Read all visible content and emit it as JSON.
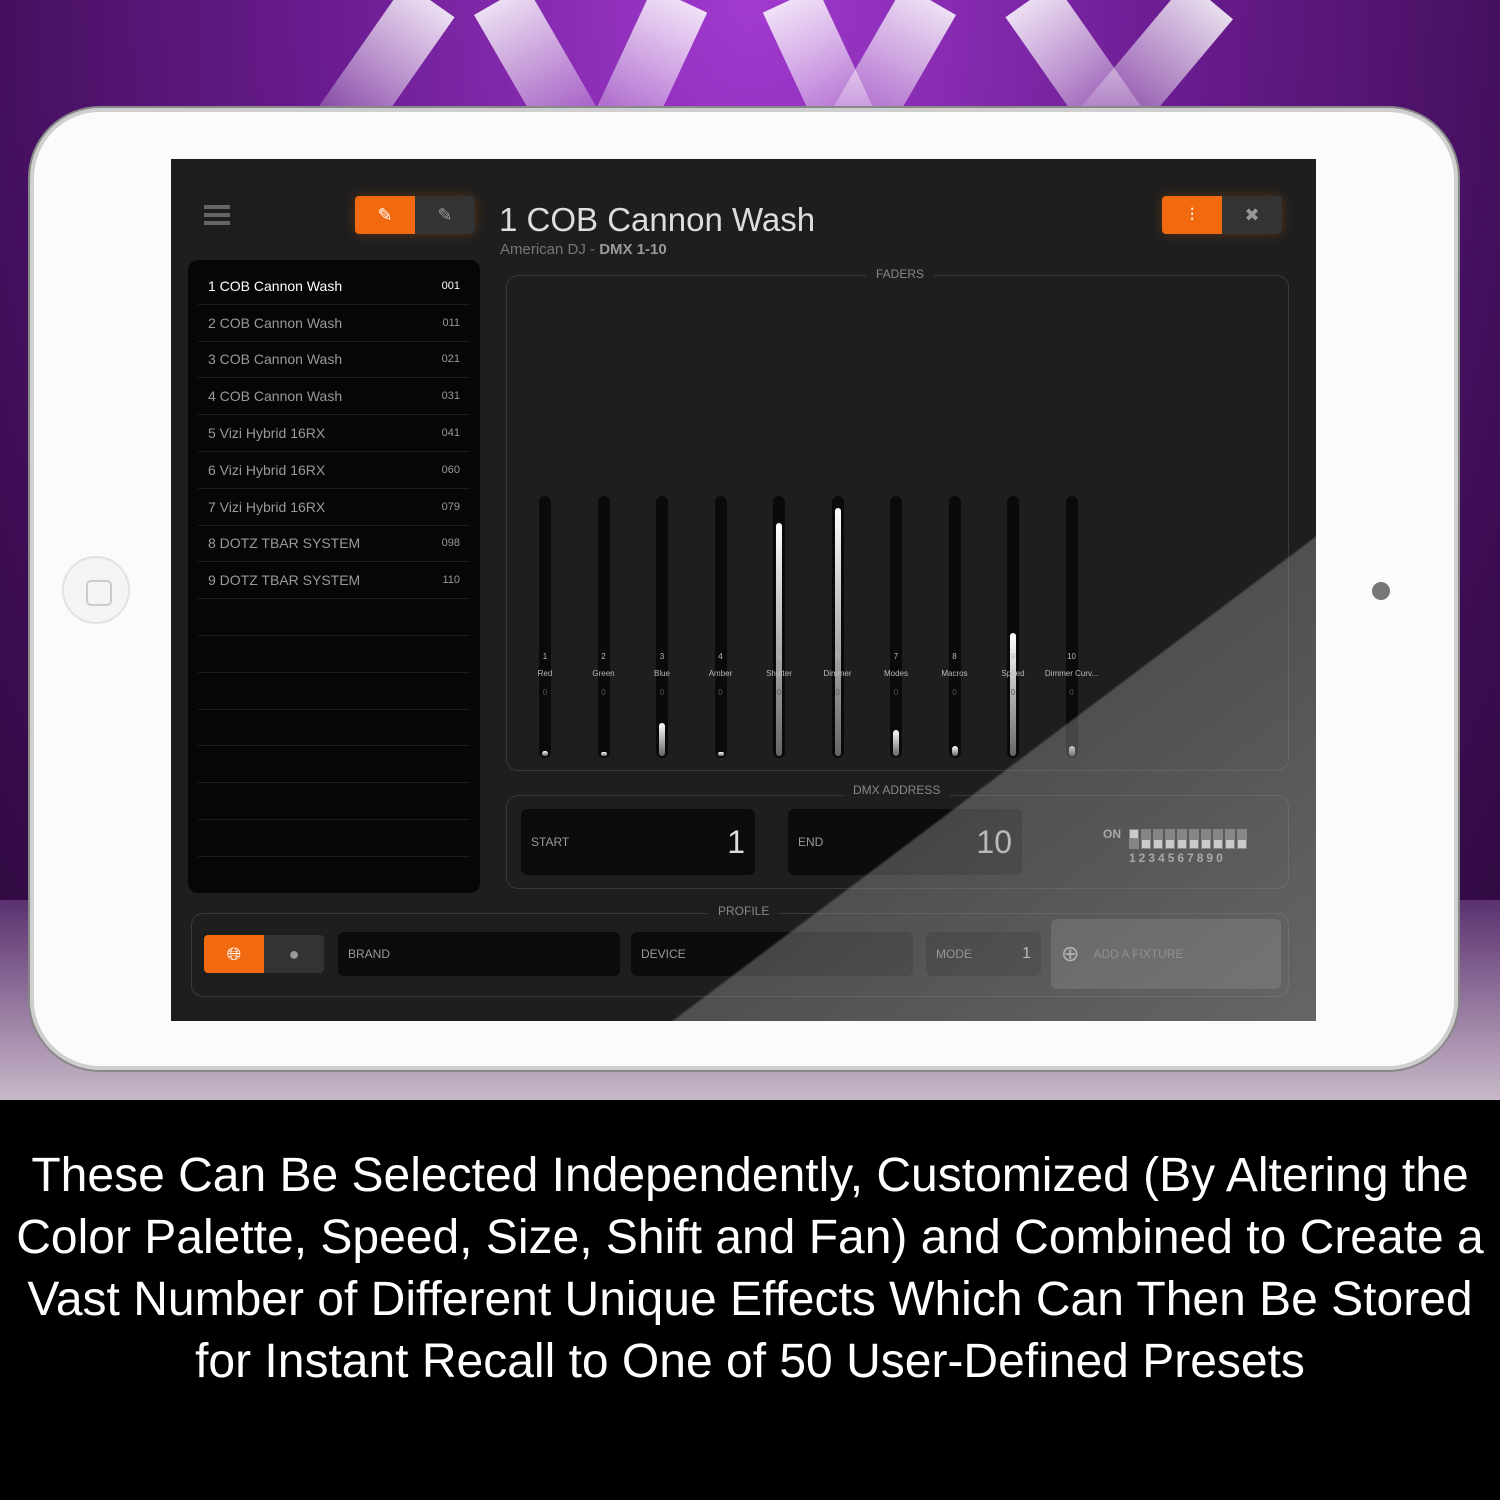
{
  "app": {
    "title": "1 COB Cannon Wash",
    "subtitle_brand": "American DJ",
    "subtitle_sep": " - ",
    "subtitle_dmx": "DMX 1-10",
    "accent": "#f26a10"
  },
  "fixtures": [
    {
      "name": "1 COB Cannon Wash",
      "addr": "001",
      "selected": true
    },
    {
      "name": "2 COB Cannon Wash",
      "addr": "011"
    },
    {
      "name": "3 COB Cannon Wash",
      "addr": "021"
    },
    {
      "name": "4 COB Cannon Wash",
      "addr": "031"
    },
    {
      "name": "5 Vizi Hybrid 16RX",
      "addr": "041"
    },
    {
      "name": "6 Vizi Hybrid 16RX",
      "addr": "060"
    },
    {
      "name": "7 Vizi Hybrid 16RX",
      "addr": "079"
    },
    {
      "name": "8 DOTZ TBAR SYSTEM",
      "addr": "098"
    },
    {
      "name": "9 DOTZ TBAR SYSTEM",
      "addr": "110"
    }
  ],
  "faders": {
    "label": "FADERS",
    "channels": [
      {
        "num": "1",
        "name": "Red",
        "value": "0",
        "level": 0.02
      },
      {
        "num": "2",
        "name": "Green",
        "value": "0",
        "level": 0.0
      },
      {
        "num": "3",
        "name": "Blue",
        "value": "0",
        "level": 0.13
      },
      {
        "num": "4",
        "name": "Amber",
        "value": "0",
        "level": 0.0
      },
      {
        "num": "5",
        "name": "Shutter",
        "value": "0",
        "level": 0.91
      },
      {
        "num": "6",
        "name": "Dimmer",
        "value": "0",
        "level": 0.97
      },
      {
        "num": "7",
        "name": "Modes",
        "value": "0",
        "level": 0.1
      },
      {
        "num": "8",
        "name": "Macros",
        "value": "0",
        "level": 0.04
      },
      {
        "num": "9",
        "name": "Speed",
        "value": "0",
        "level": 0.48
      },
      {
        "num": "10",
        "name": "Dimmer Curv...",
        "value": "0",
        "level": 0.04
      }
    ]
  },
  "dmx": {
    "label": "DMX ADDRESS",
    "start_label": "START",
    "start": "1",
    "end_label": "END",
    "end": "10",
    "dip_on": "ON",
    "dip_digits": "1234567890",
    "dip_states": [
      true,
      false,
      false,
      false,
      false,
      false,
      false,
      false,
      false,
      false
    ]
  },
  "profile": {
    "label": "PROFILE",
    "brand_label": "BRAND",
    "device_label": "DEVICE",
    "mode_label": "MODE",
    "mode": "1",
    "add_fixture": "ADD A FIXTURE"
  },
  "icons": {
    "menu": "hamburger-icon",
    "tab1": "fixture-icon",
    "tab2": "fixtures-icon",
    "faders": "sliders-icon",
    "fullscreen": "expand-icon",
    "globe": "globe-icon",
    "user": "user-icon",
    "add": "add-fixture-icon"
  },
  "caption": "These Can Be Selected Independently, Customized (By Altering the Color Palette, Speed, Size, Shift and Fan) and Combined to Create a Vast Number of Different Unique Effects Which Can Then Be Stored for Instant Recall to One of 50 User-Defined Presets"
}
